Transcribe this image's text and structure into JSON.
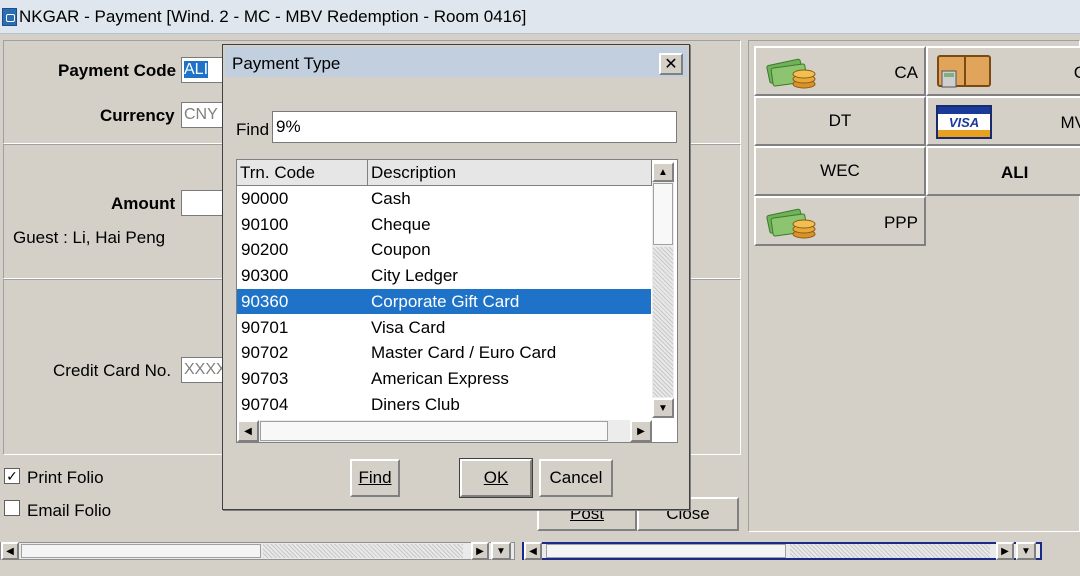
{
  "window": {
    "title": "NKGAR - Payment  [Wind. 2 - MC - MBV Redemption - Room 0416]"
  },
  "form": {
    "payment_code_label": "Payment Code",
    "payment_code_value": "ALI",
    "currency_label": "Currency",
    "currency_value": "CNY",
    "amount_label": "Amount",
    "amount_value": "",
    "guest_text": "Guest : Li, Hai Peng",
    "credit_card_label": "Credit Card No.",
    "credit_card_value": "XXXX",
    "print_folio_label": "Print Folio",
    "print_folio_checked": true,
    "email_folio_label": "Email Folio",
    "email_folio_checked": false,
    "post_label": "Post",
    "close_label": "Close"
  },
  "payment_buttons": [
    {
      "label": "CA",
      "icon": "cash-icon"
    },
    {
      "label": "C",
      "icon": "calculator-ledger-icon"
    },
    {
      "label": "DT",
      "icon": ""
    },
    {
      "label": "MV",
      "icon": "visa-card-icon"
    },
    {
      "label": "WEC",
      "icon": ""
    },
    {
      "label": "ALI",
      "icon": ""
    },
    {
      "label": "PPP",
      "icon": "cash-icon"
    }
  ],
  "dialog": {
    "title": "Payment Type",
    "find_label": "Find",
    "find_value": "9%",
    "columns": [
      "Trn. Code",
      "Description"
    ],
    "rows": [
      {
        "code": "90000",
        "description": "Cash"
      },
      {
        "code": "90100",
        "description": "Cheque"
      },
      {
        "code": "90200",
        "description": "Coupon"
      },
      {
        "code": "90300",
        "description": "City Ledger"
      },
      {
        "code": "90360",
        "description": "Corporate Gift Card"
      },
      {
        "code": "90701",
        "description": "Visa Card"
      },
      {
        "code": "90702",
        "description": "Master Card / Euro Card"
      },
      {
        "code": "90703",
        "description": "American Express"
      },
      {
        "code": "90704",
        "description": "Diners Club"
      }
    ],
    "selected_row_index": 4,
    "find_button": "Find",
    "ok_button": "OK",
    "cancel_button": "Cancel"
  },
  "colors": {
    "selection": "#1e73c8",
    "dialog_title_bg": "#c2cfde",
    "window_bg": "#d4d0c8"
  }
}
